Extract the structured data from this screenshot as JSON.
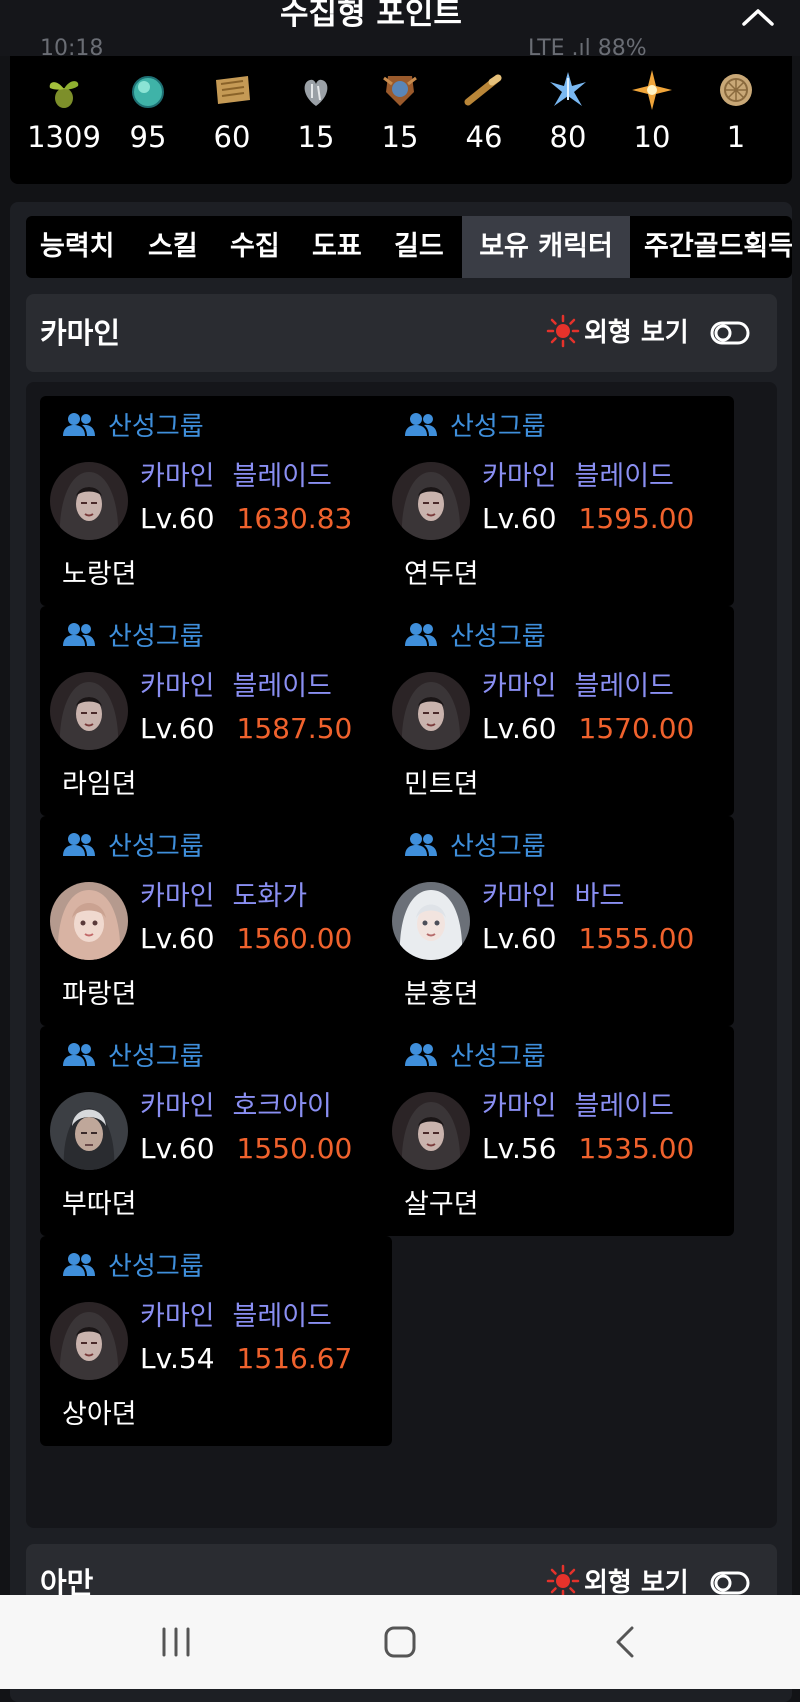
{
  "header": {
    "title": "수집형 포인트",
    "status_time": "10:18",
    "status_right": "LTE .ıl 88%"
  },
  "points": [
    {
      "icon": "mokoko-seed-icon",
      "value": "1309"
    },
    {
      "icon": "island-heart-icon",
      "value": "95"
    },
    {
      "icon": "masterpiece-icon",
      "value": "60"
    },
    {
      "icon": "giant-heart-icon",
      "value": "15"
    },
    {
      "icon": "ignea-token-icon",
      "value": "15"
    },
    {
      "icon": "sea-bounty-icon",
      "value": "46"
    },
    {
      "icon": "world-tree-leaf-icon",
      "value": "80"
    },
    {
      "icon": "orpheus-star-icon",
      "value": "10"
    },
    {
      "icon": "islands-soul-icon",
      "value": "1"
    }
  ],
  "tabs": [
    "능력치",
    "스킬",
    "수집",
    "도표",
    "길드",
    "보유 캐릭터",
    "주간골드획득"
  ],
  "active_tab": "보유 캐릭터",
  "sections": [
    {
      "name": "카마인",
      "view_label": "외형 보기"
    },
    {
      "name": "아만",
      "view_label": "외형 보기"
    }
  ],
  "characters": [
    {
      "guild": "산성그룹",
      "server": "카마인",
      "class": "블레이드",
      "level": "Lv.60",
      "item_level": "1630.83",
      "name": "노랑뎐",
      "avatar": "blade"
    },
    {
      "guild": "산성그룹",
      "server": "카마인",
      "class": "블레이드",
      "level": "Lv.60",
      "item_level": "1595.00",
      "name": "연두뎐",
      "avatar": "blade"
    },
    {
      "guild": "산성그룹",
      "server": "카마인",
      "class": "블레이드",
      "level": "Lv.60",
      "item_level": "1587.50",
      "name": "라임뎐",
      "avatar": "blade"
    },
    {
      "guild": "산성그룹",
      "server": "카마인",
      "class": "블레이드",
      "level": "Lv.60",
      "item_level": "1570.00",
      "name": "민트뎐",
      "avatar": "blade"
    },
    {
      "guild": "산성그룹",
      "server": "카마인",
      "class": "도화가",
      "level": "Lv.60",
      "item_level": "1560.00",
      "name": "파랑뎐",
      "avatar": "artist"
    },
    {
      "guild": "산성그룹",
      "server": "카마인",
      "class": "바드",
      "level": "Lv.60",
      "item_level": "1555.00",
      "name": "분홍뎐",
      "avatar": "bard"
    },
    {
      "guild": "산성그룹",
      "server": "카마인",
      "class": "호크아이",
      "level": "Lv.60",
      "item_level": "1550.00",
      "name": "부따뎐",
      "avatar": "hawkeye"
    },
    {
      "guild": "산성그룹",
      "server": "카마인",
      "class": "블레이드",
      "level": "Lv.56",
      "item_level": "1535.00",
      "name": "살구뎐",
      "avatar": "blade"
    },
    {
      "guild": "산성그룹",
      "server": "카마인",
      "class": "블레이드",
      "level": "Lv.54",
      "item_level": "1516.67",
      "name": "상아뎐",
      "avatar": "blade"
    }
  ],
  "colors": {
    "guild_blue": "#3f8fdb",
    "class_purple": "#8a8ff2",
    "item_level_orange": "#f0622d",
    "sun_red": "#e5322b"
  },
  "nav": [
    "recent-apps-icon",
    "home-icon",
    "back-icon"
  ]
}
